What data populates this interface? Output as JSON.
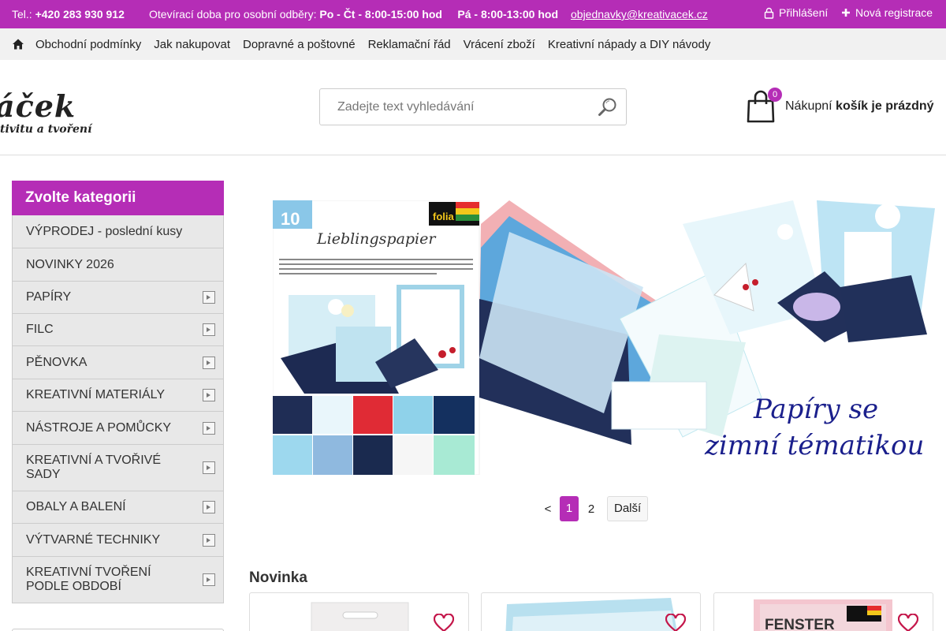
{
  "topbar": {
    "tel_label": "Tel.:",
    "tel_value": "+420 283 930 912",
    "hours_label": "Otevírací doba pro osobní odběry:",
    "hours_weekdays": "Po - Čt - 8:00-15:00 hod",
    "hours_friday": "Pá - 8:00-13:00 hod",
    "email": "objednavky@kreativacek.cz",
    "login": "Přihlášení",
    "register": "Nová registrace"
  },
  "nav": {
    "items": [
      "Obchodní podmínky",
      "Jak nakupovat",
      "Dopravné a poštovné",
      "Reklamační řád",
      "Vrácení zboží",
      "Kreativní nápady a DIY návody"
    ]
  },
  "header": {
    "logo_line1": "áček",
    "logo_line2": "tivitu a tvoření",
    "search_placeholder": "Zadejte text vyhledávání",
    "cart_count": "0",
    "cart_text_normal": "Nákupní",
    "cart_text_bold": "košík je prázdný"
  },
  "sidebar": {
    "title": "Zvolte kategorii",
    "categories": [
      {
        "label": "VÝPRODEJ - poslední kusy",
        "has_sub": false
      },
      {
        "label": "NOVINKY 2026",
        "has_sub": false
      },
      {
        "label": "PAPÍRY",
        "has_sub": true
      },
      {
        "label": "FILC",
        "has_sub": true
      },
      {
        "label": "PĚNOVKA",
        "has_sub": true
      },
      {
        "label": "KREATIVNÍ MATERIÁLY",
        "has_sub": true
      },
      {
        "label": "NÁSTROJE A POMŮCKY",
        "has_sub": true
      },
      {
        "label": "KREATIVNÍ A TVOŘIVÉ SADY",
        "has_sub": true
      },
      {
        "label": "OBALY A BALENÍ",
        "has_sub": true
      },
      {
        "label": "VÝTVARNÉ TECHNIKY",
        "has_sub": true
      },
      {
        "label": "KREATIVNÍ TVOŘENÍ PODLE OBDOBÍ",
        "has_sub": true
      }
    ]
  },
  "banner": {
    "pack_title": "Lieblingspapier",
    "pack_count": "10",
    "brand": "folia",
    "headline_1": "Papíry se",
    "headline_2": "zimní tématikou"
  },
  "pager": {
    "prev": "<",
    "page1": "1",
    "page2": "2",
    "next": "Další"
  },
  "products": {
    "section_title": "Novinka",
    "card3_label": "FENSTER"
  },
  "colors": {
    "accent": "#b52db6",
    "sidebar_bg": "#e8e8e8",
    "nav_bg": "#f1f1f1"
  }
}
